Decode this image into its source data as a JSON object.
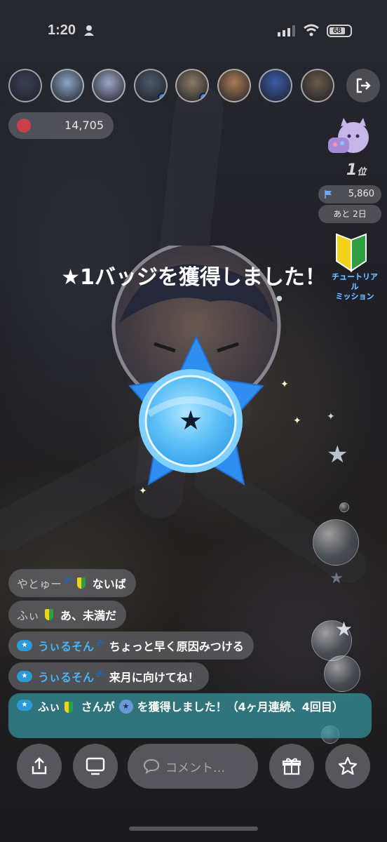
{
  "status_bar": {
    "time": "1:20",
    "battery": "68"
  },
  "viewers": {
    "avatars": [
      {
        "name": "avatar-1",
        "color": "#3b3f55",
        "verified": false
      },
      {
        "name": "avatar-2",
        "color": "#8aa6c4",
        "verified": false
      },
      {
        "name": "avatar-3",
        "color": "#9ea8c8",
        "verified": false
      },
      {
        "name": "avatar-4",
        "color": "#4c5a6c",
        "verified": true
      },
      {
        "name": "avatar-5",
        "color": "#8a7a66",
        "verified": true
      },
      {
        "name": "avatar-6",
        "color": "#a87c56",
        "verified": false
      },
      {
        "name": "avatar-7",
        "color": "#3a5ca8",
        "verified": false
      },
      {
        "name": "avatar-8",
        "color": "#6a5a48",
        "verified": false
      }
    ]
  },
  "score": {
    "value": "14,705"
  },
  "ranking": {
    "rank_num": "1",
    "rank_suffix": "位",
    "points": "5,860",
    "remaining": "あと 2日"
  },
  "mission": {
    "line1": "チュートリアル",
    "line2": "ミッション"
  },
  "badge_popup": {
    "title": "★1バッジを獲得しました！"
  },
  "chat": [
    {
      "name": "やとゅー",
      "suffix": "💤",
      "beginner": true,
      "starchip": false,
      "name_style": "gray",
      "message": "ないば"
    },
    {
      "name": "ふぃ",
      "suffix": "",
      "beginner": true,
      "starchip": false,
      "name_style": "gray",
      "message": "あ、未満だ"
    },
    {
      "name": "うぃるそん",
      "suffix": "💤",
      "beginner": false,
      "starchip": true,
      "name_style": "blue",
      "message": "ちょっと早く原因みつける"
    },
    {
      "name": "うぃるそん",
      "suffix": "💤",
      "beginner": false,
      "starchip": true,
      "name_style": "blue",
      "message": "来月に向けてね！"
    }
  ],
  "notice": {
    "name": "ふぃ",
    "mid": "さんが",
    "end": "を獲得しました！（4ヶ月連続、4回目）"
  },
  "comment": {
    "placeholder": "コメント…"
  },
  "colors": {
    "badge_blue": "#2f8ef0",
    "badge_light": "#7fd0ff",
    "chat_blue": "#42b6f5",
    "notice_bg": "#3696a0"
  }
}
